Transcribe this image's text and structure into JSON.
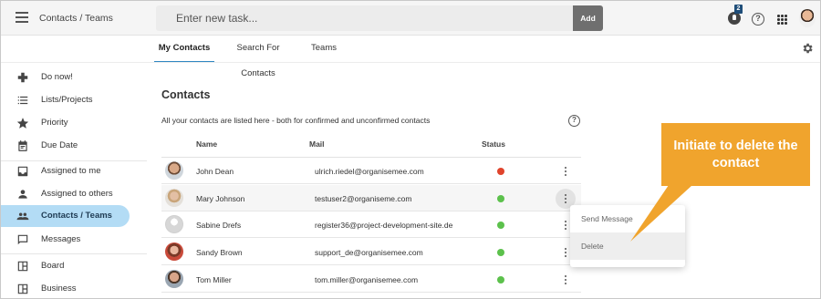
{
  "header": {
    "app_title": "Contacts / Teams",
    "task_placeholder": "Enter new task...",
    "add_label": "Add",
    "notification_count": "2",
    "help_symbol": "?"
  },
  "tabs": [
    {
      "label": "My Contacts",
      "active": true
    },
    {
      "label": "Search For Contacts",
      "active": false
    },
    {
      "label": "Teams",
      "active": false
    }
  ],
  "sidebar": {
    "items": [
      {
        "label": "Do now!",
        "icon": "gamepad-icon"
      },
      {
        "label": "Lists/Projects",
        "icon": "list-icon"
      },
      {
        "label": "Priority",
        "icon": "star-icon"
      },
      {
        "label": "Due Date",
        "icon": "calendar-icon"
      },
      {
        "label": "Assigned to me",
        "icon": "inbox-icon"
      },
      {
        "label": "Assigned to others",
        "icon": "person-icon"
      },
      {
        "label": "Contacts / Teams",
        "icon": "people-icon",
        "active": true
      },
      {
        "label": "Messages",
        "icon": "message-icon"
      },
      {
        "label": "Board",
        "icon": "board-icon"
      },
      {
        "label": "Business",
        "icon": "board-icon"
      }
    ]
  },
  "main": {
    "heading": "Contacts",
    "description": "All your contacts are listed here - both for confirmed and unconfirmed contacts",
    "help_symbol": "?",
    "columns": {
      "name": "Name",
      "mail": "Mail",
      "status": "Status"
    },
    "contacts": [
      {
        "name": "John Dean",
        "mail": "ulrich.riedel@organisemee.com",
        "status": "red"
      },
      {
        "name": "Mary Johnson",
        "mail": "testuser2@organiseme.com",
        "status": "green"
      },
      {
        "name": "Sabine Drefs",
        "mail": "register36@project-development-site.de",
        "status": "green"
      },
      {
        "name": "Sandy Brown",
        "mail": "support_de@organisemee.com",
        "status": "green"
      },
      {
        "name": "Tom Miller",
        "mail": "tom.miller@organisemee.com",
        "status": "green"
      }
    ]
  },
  "context_menu": {
    "items": [
      "Send Message",
      "Delete"
    ]
  },
  "callout": {
    "text": "Initiate to delete the contact"
  },
  "colors": {
    "accent": "#2e86c1",
    "active_sidebar": "#b3dcf5",
    "status_red": "#e0442c",
    "status_green": "#5cc14c",
    "callout": "#f0a42d"
  }
}
